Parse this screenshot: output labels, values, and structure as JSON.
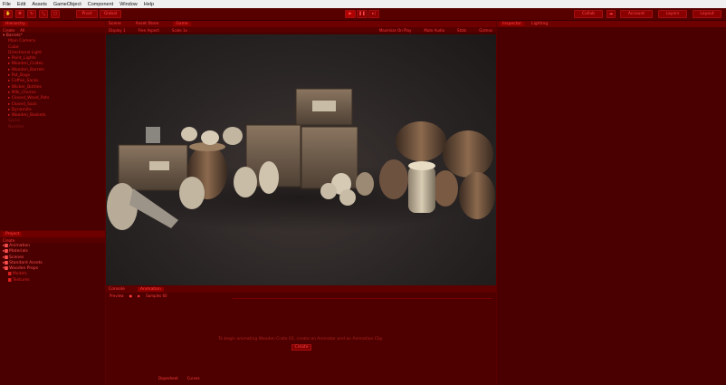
{
  "menu": [
    "File",
    "Edit",
    "Assets",
    "GameObject",
    "Component",
    "Window",
    "Help"
  ],
  "toolbar": {
    "pivot_label": "Pivot",
    "local_label": "Global",
    "collab_label": "Collab",
    "account_label": "Account",
    "layers_label": "Layers",
    "layout_label": "Layout"
  },
  "hierarchy": {
    "tab": "Hierarchy",
    "create": "Create",
    "search": "All",
    "scene": "Barrels*",
    "items": [
      "Main Camera",
      "Cube",
      "Directional Light",
      "Point_Lights",
      "Wooden_Crates",
      "Wooden_Barrels",
      "Pot_Bags",
      "Coffee_Sacks",
      "Wicker_Bottles",
      "Milk_Churns",
      "Closed_Wood_Pots",
      "Closed_Sack",
      "Dynamite",
      "Wooden_Baskets"
    ],
    "dim_items": [
      "Sacks",
      "Nozzles"
    ]
  },
  "scene_tabs": [
    "Scene",
    "Asset Store",
    "Game"
  ],
  "scene_bar": {
    "display": "Display 1",
    "aspect": "Free Aspect",
    "scale": "Scale 1x",
    "maximize": "Maximize On Play",
    "mute": "Mute Audio",
    "stats": "Stats",
    "gizmos": "Gizmos"
  },
  "inspector_tabs": [
    "Inspector",
    "Lighting"
  ],
  "project": {
    "tab": "Project",
    "create": "Create",
    "folders": [
      "Animation",
      "Materials",
      "Scenes",
      "Standard Assets",
      "Wooden Props",
      "Models",
      "Textures"
    ]
  },
  "bottom_tabs": [
    "Console",
    "Animation"
  ],
  "animation": {
    "preview": "Preview",
    "samples": "Samples 60",
    "message": "To begin animating Wooden Crate 01, create an Animator and an Animation Clip.",
    "create_button": "Create",
    "dopesheet": "Dopesheet",
    "curves": "Curves"
  }
}
